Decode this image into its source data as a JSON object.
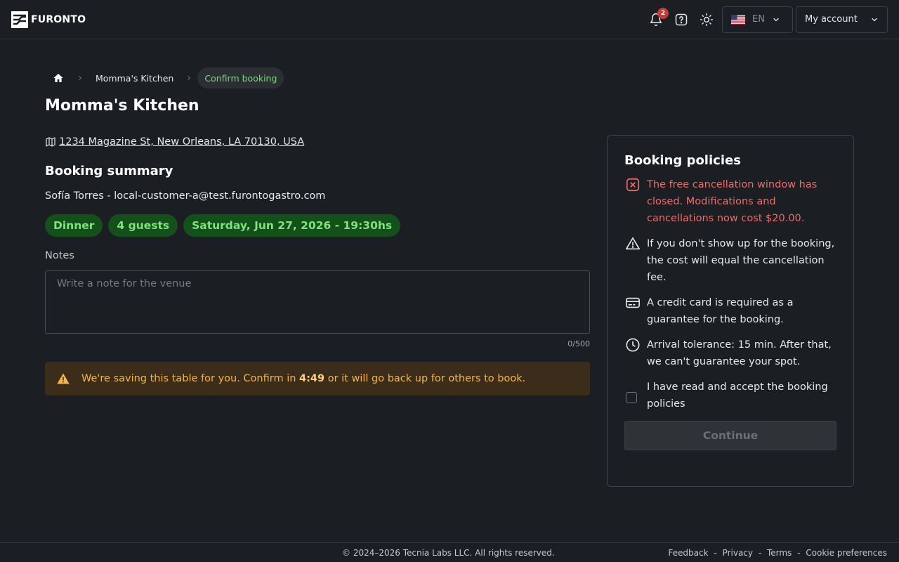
{
  "app": {
    "name": "FURONTO"
  },
  "header": {
    "notifications_count": "2",
    "language_code": "EN",
    "account_label": "My account"
  },
  "breadcrumb": {
    "home_icon": "home-icon",
    "venue": "Momma's Kitchen",
    "current": "Confirm booking"
  },
  "venue": {
    "title": "Momma's Kitchen",
    "address": "1234 Magazine St, New Orleans, LA 70130, USA"
  },
  "summary": {
    "title": "Booking summary",
    "customer": "Sofía Torres - local-customer-a@test.furontogastro.com",
    "chips": [
      "Dinner",
      "4 guests",
      "Saturday, Jun 27, 2026 - 19:30hs"
    ]
  },
  "notes": {
    "label": "Notes",
    "placeholder": "Write a note for the venue",
    "value": "",
    "counter": "0/500"
  },
  "hold_alert": {
    "text_before": "We're saving this table for you. Confirm in ",
    "timer": "4:49",
    "text_after": " or it will go back up for others to book."
  },
  "policies": {
    "title": "Booking policies",
    "items": [
      {
        "icon": "x-square-icon",
        "text": "The free cancellation window has closed. Modifications and cancellations now cost $20.00."
      },
      {
        "icon": "warning-triangle-icon",
        "text": "If you don't show up for the booking, the cost will equal the cancellation fee."
      },
      {
        "icon": "credit-card-icon",
        "text": "A credit card is required as a guarantee for the booking."
      },
      {
        "icon": "clock-icon",
        "text": "Arrival tolerance: 15 min. After that, we can't guarantee your spot."
      }
    ],
    "accept_label": "I have read and accept the booking policies",
    "accepted": false,
    "continue_label": "Continue"
  },
  "footer": {
    "copyright": "© 2024–2026 Tecnia Labs LLC. All rights reserved.",
    "links": [
      "Feedback",
      "Privacy",
      "Terms",
      "Cookie preferences"
    ],
    "separator": " - "
  },
  "colors": {
    "background": "#1b1e22",
    "accent_green": "#6fdc71",
    "chip_bg": "#14501a",
    "danger": "#ef6b6b",
    "warning": "#f5b547",
    "badge": "#c73a3a"
  }
}
